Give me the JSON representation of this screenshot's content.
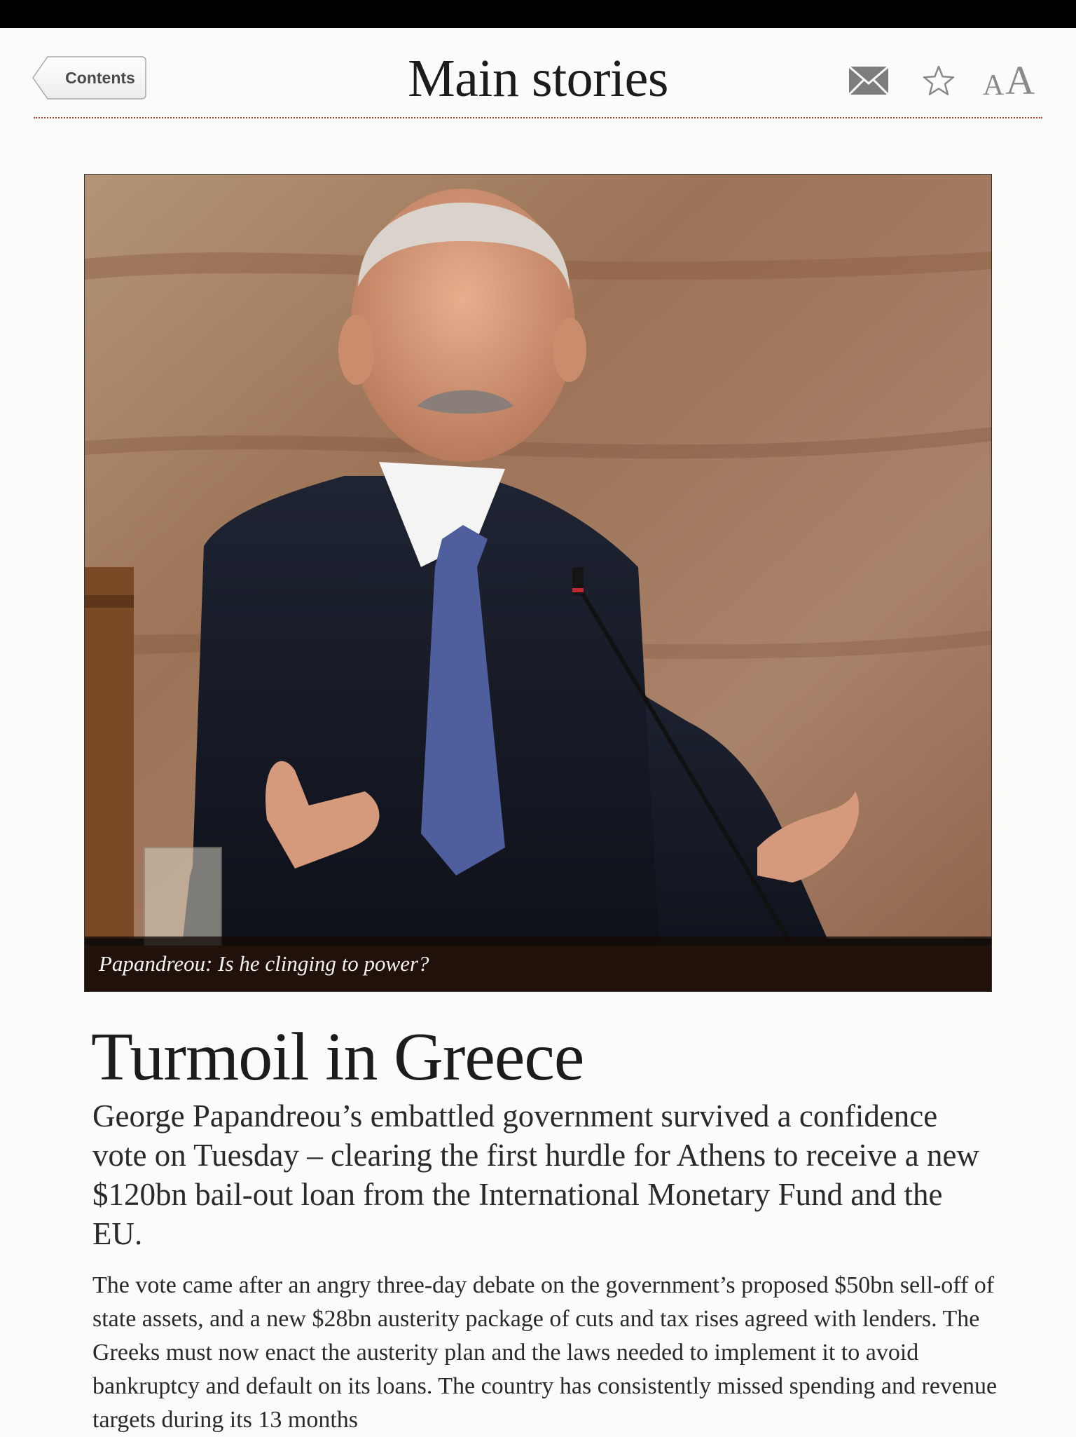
{
  "nav": {
    "back_label": "Contents",
    "title": "Main stories",
    "icons": {
      "mail": "mail-icon",
      "star": "star-icon",
      "font_size": "font-size-icon"
    },
    "font_small": "A",
    "font_large": "A"
  },
  "article": {
    "photo_caption": "Papandreou: Is he clinging to power?",
    "headline": "Turmoil in Greece",
    "standfirst": "George Papandreou’s embattled government survived a confidence vote on Tuesday – clearing the first hurdle for Athens to receive a new $120bn bail-out loan from the International Monetary Fund and the EU.",
    "body": "The vote came after an angry three-day debate on the government’s proposed $50bn sell-off of state assets, and a new $28bn austerity package of cuts and tax rises agreed with lenders. The Greeks must now enact the austerity plan and the laws needed to implement it to avoid bankruptcy and default on its loans. The country has consistently missed spending and revenue targets during its 13 months"
  },
  "colors": {
    "status_bar": "#000000",
    "divider": "#c0392b",
    "background": "#fbfbf9"
  }
}
